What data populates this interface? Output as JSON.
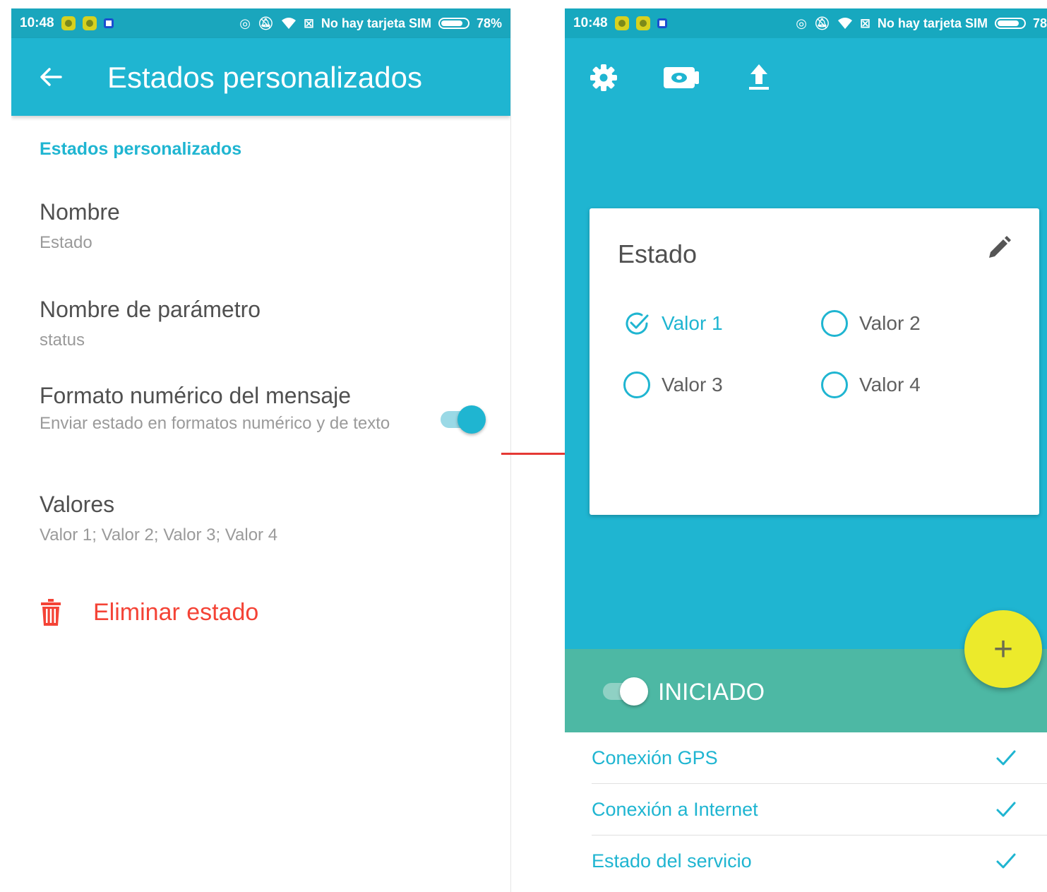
{
  "colors": {
    "primary": "#1fb5d1",
    "status_bar": "#1aa6bd",
    "green_bar": "#4db8a4",
    "fab": "#ecea2b",
    "danger": "#f44336",
    "arrow": "#e53935"
  },
  "left_screen": {
    "status_bar": {
      "time": "10:48",
      "carrier": "No hay tarjeta SIM",
      "battery": "78%",
      "icons": [
        "notification-icon",
        "notification-icon",
        "notification-icon",
        "vibrate-icon",
        "mute-icon",
        "wifi-icon",
        "sim-icon",
        "battery-icon"
      ]
    },
    "app_bar": {
      "back_icon": "arrow-left-icon",
      "title": "Estados personalizados"
    },
    "section_header": "Estados personalizados",
    "prefs": {
      "name": {
        "title": "Nombre",
        "value": "Estado"
      },
      "param": {
        "title": "Nombre de parámetro",
        "value": "status"
      },
      "numeric": {
        "title": "Formato numérico del mensaje",
        "summary": "Enviar estado en formatos numérico y de texto",
        "enabled": true
      },
      "values": {
        "title": "Valores",
        "value": "Valor 1; Valor 2; Valor 3; Valor 4"
      }
    },
    "delete": {
      "icon": "trash-icon",
      "label": "Eliminar estado"
    }
  },
  "right_screen": {
    "status_bar": {
      "time": "10:48",
      "carrier": "No hay tarjeta SIM",
      "battery": "78"
    },
    "toolbar_icons": [
      "gear-icon",
      "camera-icon",
      "upload-icon"
    ],
    "card": {
      "title": "Estado",
      "edit_icon": "pencil-icon",
      "options": [
        {
          "label": "Valor 1",
          "selected": true
        },
        {
          "label": "Valor 2",
          "selected": false
        },
        {
          "label": "Valor 3",
          "selected": false
        },
        {
          "label": "Valor 4",
          "selected": false
        }
      ]
    },
    "fab": {
      "icon": "plus-icon",
      "label": "+"
    },
    "tracking": {
      "label": "INICIADO",
      "enabled": true
    },
    "status_items": [
      {
        "label": "Conexión GPS",
        "ok": true
      },
      {
        "label": "Conexión a Internet",
        "ok": true
      },
      {
        "label": "Estado del servicio",
        "ok": true
      }
    ]
  }
}
